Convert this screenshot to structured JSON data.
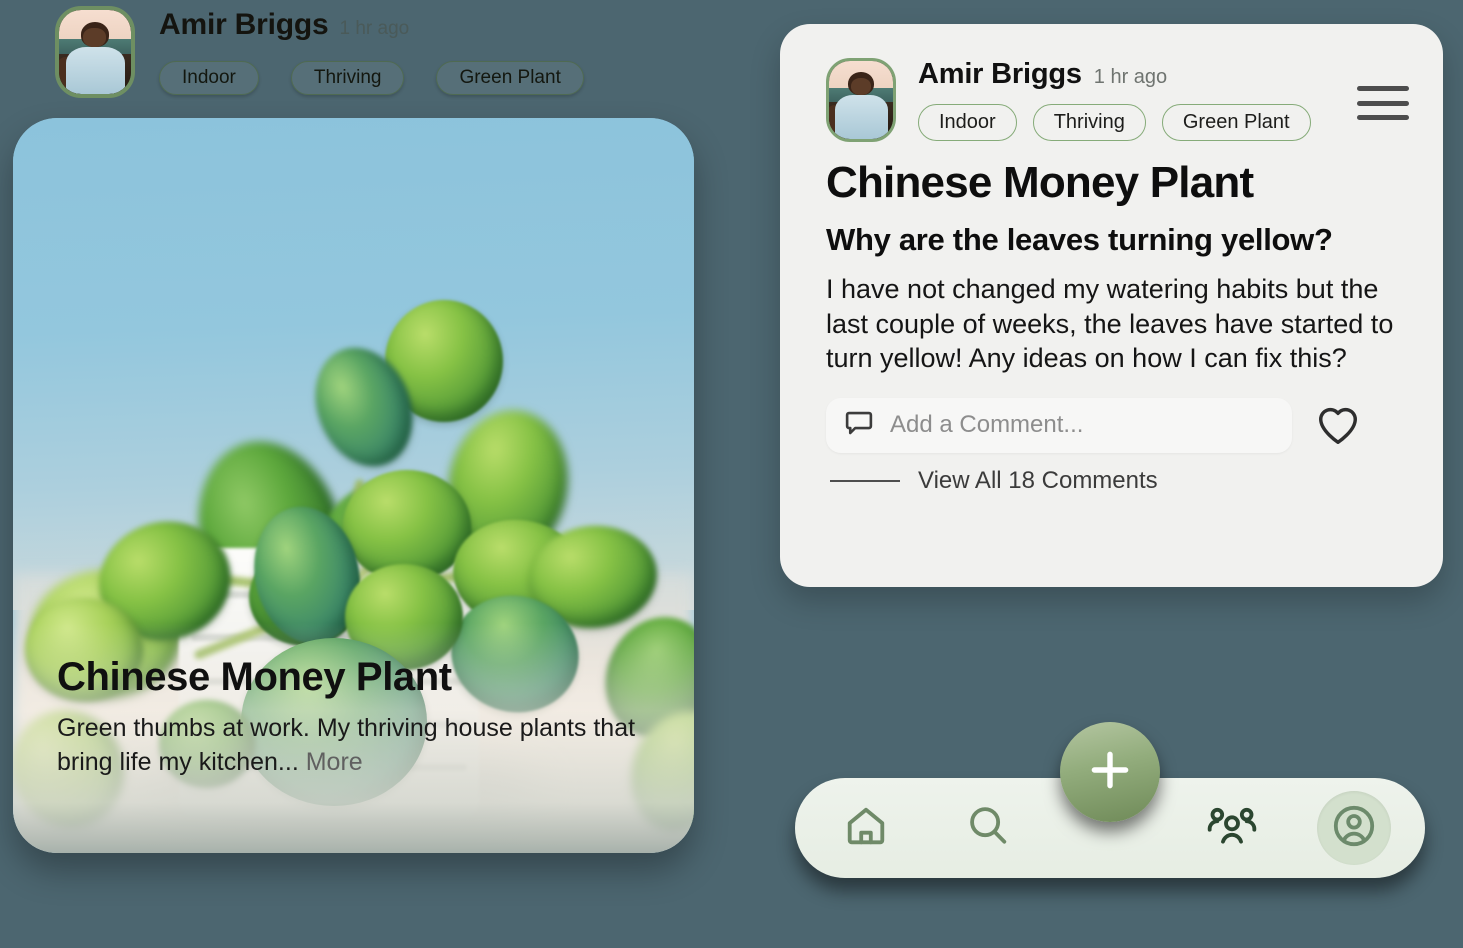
{
  "theme": {
    "page_background": "#4c6670",
    "card_background": "#f1f1ef",
    "accent_green": "#6e8f62",
    "pill_border": "#86ab79",
    "nav_background": "#e9efe7",
    "fab_green": "#6f8a58",
    "active_pill": "#d3e0cd"
  },
  "feed_preview": {
    "author": "Amir Briggs",
    "timestamp": "1 hr ago",
    "avatar_alt": "Amir Briggs profile photo",
    "tags": [
      "Indoor",
      "Thriving",
      "Green Plant"
    ],
    "photo_alt": "Chinese Money Plant in a white slatted pot against a blue sky",
    "title": "Chinese Money Plant",
    "description": "Green thumbs at work. My thriving house plants that bring life my kitchen...",
    "more_label": "More"
  },
  "post_card": {
    "author": "Amir Briggs",
    "timestamp": "1 hr ago",
    "avatar_alt": "Amir Briggs profile photo",
    "tags": [
      "Indoor",
      "Thriving",
      "Green Plant"
    ],
    "menu_icon": "hamburger-menu-icon",
    "title": "Chinese Money Plant",
    "question": "Why are the leaves turning yellow?",
    "body": "I have not changed my watering habits but the last couple of weeks, the leaves have started to turn yellow! Any ideas on how I can fix this?",
    "comment_input": {
      "placeholder": "Add a Comment...",
      "value": "",
      "icon": "comment-bubble-icon"
    },
    "like_icon": "heart-outline-icon",
    "view_all_comments": "View All 18 Comments",
    "comment_count": 18
  },
  "bottom_nav": {
    "items": [
      {
        "id": "home",
        "icon": "home-icon",
        "label": "Home",
        "active": false
      },
      {
        "id": "search",
        "icon": "search-icon",
        "label": "Search",
        "active": false
      },
      {
        "id": "community",
        "icon": "people-group-icon",
        "label": "Community",
        "active": false
      },
      {
        "id": "profile",
        "icon": "profile-circle-icon",
        "label": "Profile",
        "active": true
      }
    ],
    "fab": {
      "icon": "plus-icon",
      "label": "Create Post"
    }
  }
}
